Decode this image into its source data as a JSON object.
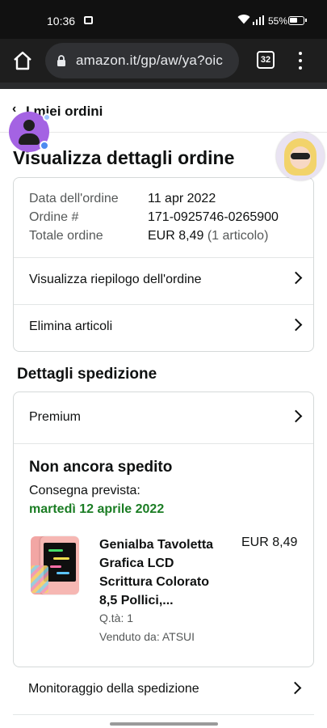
{
  "status_bar": {
    "time": "10:36",
    "battery": "55%"
  },
  "browser": {
    "url": "amazon.it/gp/aw/ya?oic",
    "tab_count": "32"
  },
  "breadcrumb": {
    "label": "I miei ordini"
  },
  "page_title": "Visualizza dettagli ordine",
  "order_info": {
    "date_label": "Data dell'ordine",
    "date_value": "11 apr 2022",
    "order_label": "Ordine #",
    "order_value": "171-0925746-0265900",
    "total_label": "Totale ordine",
    "total_value": "EUR 8,49",
    "total_items": "(1 articolo)"
  },
  "actions": {
    "summary": "Visualizza riepilogo dell'ordine",
    "delete": "Elimina articoli"
  },
  "shipping": {
    "section_title": "Dettagli spedizione",
    "service": "Premium",
    "status": "Non ancora spedito",
    "expected_label": "Consegna prevista:",
    "expected_date": "martedì 12 aprile 2022",
    "date_color": "#1b7d24"
  },
  "product": {
    "name": "Genialba Tavoletta Grafica LCD Scrittura Colorato 8,5 Pollici,...",
    "price": "EUR 8,49",
    "qty": "Q.tà: 1",
    "seller": "Venduto da: ATSUI"
  },
  "tracking": {
    "label": "Monitoraggio della spedizione"
  },
  "colors": {
    "status_bar_bg": "#111111",
    "toolbar_bg": "#1e1e1e",
    "accent_green": "#1b7d24",
    "text": "#0f1111",
    "muted": "#565959"
  }
}
